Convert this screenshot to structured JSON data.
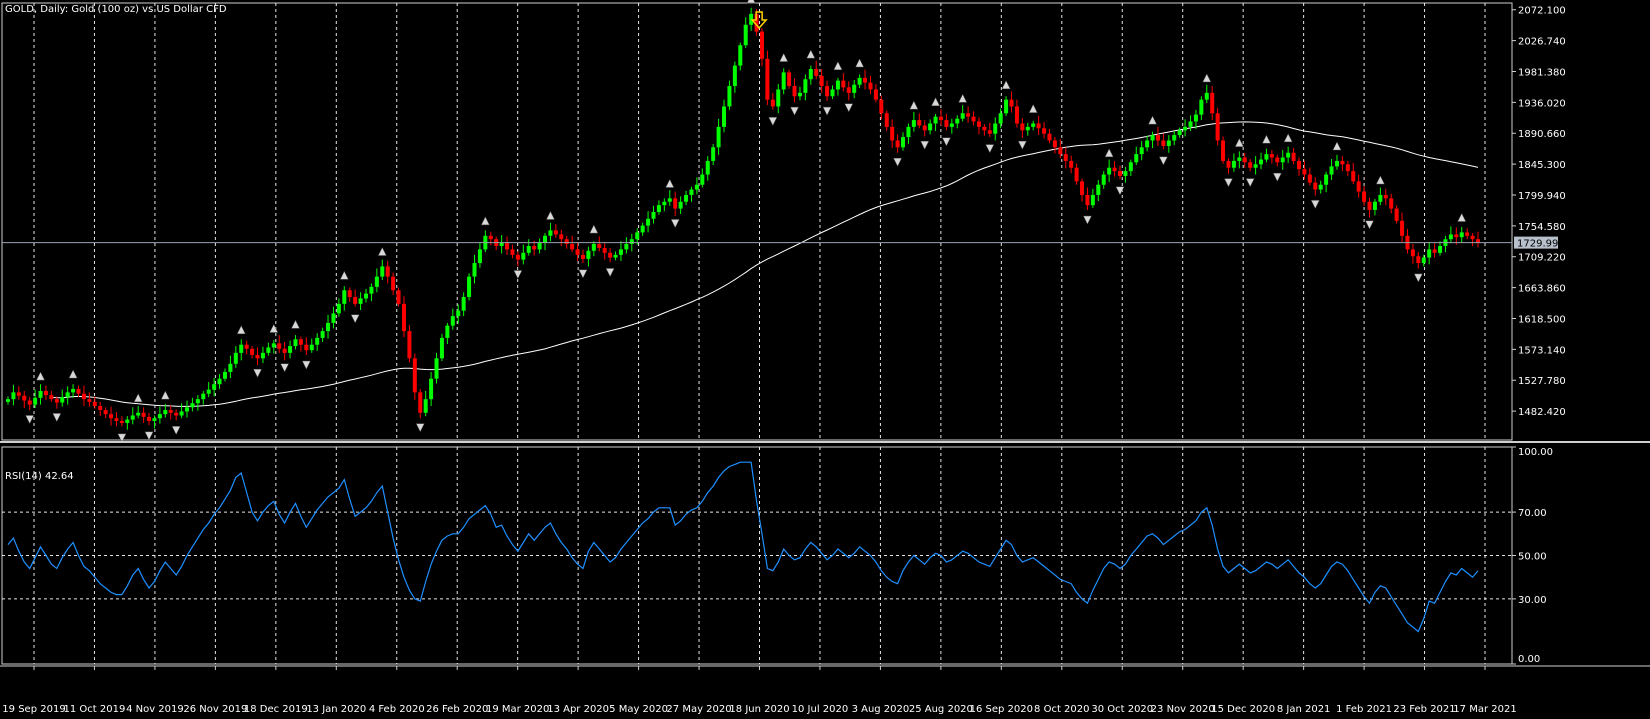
{
  "window": {
    "title": "GOLD, Daily:  Gold (100 oz) vs US Dollar CFD"
  },
  "chart_data": [
    {
      "type": "candlestick",
      "title": "GOLD, Daily:  Gold (100 oz) vs US Dollar CFD",
      "ylim": [
        1440,
        2082
      ],
      "price_ticks": [
        "2072.100",
        "2026.740",
        "1981.380",
        "1936.020",
        "1890.660",
        "1845.300",
        "1799.940",
        "1754.580",
        "1709.220",
        "1663.860",
        "1618.500",
        "1573.140",
        "1527.780",
        "1482.420"
      ],
      "current_price": {
        "value": 1729.99,
        "label": "1729.990"
      },
      "colors": {
        "up": "#00ff00",
        "down": "#ff0000",
        "ma": "#ffffff",
        "grid": "#ffffff",
        "price_line": "#9aa4b2"
      },
      "ma_period_note": "",
      "closes": [
        1500,
        1510,
        1505,
        1498,
        1492,
        1502,
        1512,
        1506,
        1500,
        1495,
        1503,
        1510,
        1515,
        1508,
        1500,
        1496,
        1490,
        1484,
        1478,
        1472,
        1468,
        1465,
        1470,
        1476,
        1480,
        1474,
        1468,
        1472,
        1478,
        1484,
        1480,
        1476,
        1482,
        1488,
        1494,
        1500,
        1508,
        1514,
        1522,
        1530,
        1540,
        1552,
        1568,
        1580,
        1574,
        1565,
        1560,
        1568,
        1576,
        1582,
        1574,
        1568,
        1578,
        1588,
        1580,
        1572,
        1580,
        1590,
        1600,
        1612,
        1626,
        1640,
        1660,
        1650,
        1640,
        1648,
        1655,
        1665,
        1680,
        1695,
        1680,
        1660,
        1640,
        1600,
        1560,
        1510,
        1480,
        1500,
        1530,
        1560,
        1590,
        1608,
        1622,
        1630,
        1650,
        1680,
        1700,
        1720,
        1740,
        1735,
        1725,
        1730,
        1720,
        1712,
        1705,
        1715,
        1725,
        1720,
        1730,
        1740,
        1748,
        1742,
        1735,
        1728,
        1720,
        1712,
        1706,
        1718,
        1728,
        1722,
        1715,
        1708,
        1712,
        1720,
        1728,
        1735,
        1745,
        1755,
        1765,
        1775,
        1785,
        1790,
        1795,
        1780,
        1790,
        1800,
        1808,
        1815,
        1830,
        1850,
        1870,
        1900,
        1930,
        1960,
        1990,
        2020,
        2050,
        2066,
        2040,
        2000,
        1940,
        1930,
        1955,
        1980,
        1960,
        1945,
        1950,
        1970,
        1985,
        1975,
        1960,
        1945,
        1955,
        1968,
        1958,
        1950,
        1962,
        1972,
        1965,
        1955,
        1940,
        1920,
        1900,
        1880,
        1870,
        1885,
        1900,
        1910,
        1902,
        1895,
        1905,
        1915,
        1910,
        1900,
        1905,
        1912,
        1920,
        1915,
        1908,
        1900,
        1895,
        1890,
        1905,
        1920,
        1940,
        1930,
        1905,
        1895,
        1900,
        1905,
        1898,
        1890,
        1880,
        1870,
        1860,
        1850,
        1840,
        1820,
        1800,
        1785,
        1800,
        1815,
        1830,
        1840,
        1835,
        1828,
        1835,
        1848,
        1860,
        1870,
        1880,
        1888,
        1880,
        1872,
        1880,
        1888,
        1895,
        1900,
        1908,
        1918,
        1940,
        1950,
        1920,
        1880,
        1850,
        1840,
        1850,
        1855,
        1848,
        1840,
        1845,
        1852,
        1860,
        1855,
        1848,
        1855,
        1862,
        1850,
        1838,
        1830,
        1818,
        1808,
        1815,
        1830,
        1842,
        1850,
        1845,
        1835,
        1820,
        1805,
        1790,
        1778,
        1790,
        1800,
        1795,
        1780,
        1762,
        1740,
        1720,
        1710,
        1700,
        1708,
        1720,
        1715,
        1725,
        1735,
        1742,
        1738,
        1745,
        1740,
        1735,
        1730
      ],
      "rsi": {
        "label": "RSI(14) 42.64",
        "ylim": [
          0,
          100
        ],
        "levels": [
          70,
          50,
          30
        ],
        "tick_labels": [
          "100.00",
          "70.00",
          "50.00",
          "30.00",
          "0.00"
        ],
        "color": "#1e90ff",
        "values": [
          55,
          58,
          52,
          47,
          44,
          49,
          54,
          50,
          46,
          44,
          49,
          53,
          56,
          50,
          45,
          43,
          40,
          37,
          35,
          33,
          32,
          32,
          36,
          41,
          44,
          39,
          35,
          38,
          43,
          47,
          44,
          41,
          45,
          50,
          54,
          58,
          62,
          65,
          69,
          72,
          76,
          80,
          86,
          88,
          79,
          70,
          66,
          70,
          73,
          75,
          69,
          65,
          70,
          74,
          68,
          63,
          67,
          71,
          74,
          77,
          79,
          81,
          85,
          76,
          68,
          70,
          72,
          75,
          79,
          82,
          70,
          58,
          48,
          40,
          34,
          30,
          29,
          38,
          46,
          52,
          57,
          59,
          60,
          60,
          63,
          67,
          69,
          71,
          73,
          69,
          63,
          64,
          59,
          55,
          52,
          56,
          60,
          57,
          60,
          63,
          65,
          60,
          56,
          53,
          49,
          46,
          44,
          52,
          56,
          53,
          50,
          47,
          49,
          53,
          56,
          59,
          62,
          65,
          67,
          70,
          72,
          72,
          72,
          64,
          66,
          69,
          71,
          72,
          75,
          79,
          82,
          86,
          89,
          91,
          92,
          93,
          93,
          93,
          75,
          60,
          44,
          43,
          47,
          53,
          50,
          48,
          49,
          53,
          56,
          54,
          51,
          48,
          50,
          53,
          51,
          49,
          51,
          54,
          52,
          50,
          47,
          43,
          40,
          38,
          37,
          43,
          47,
          50,
          48,
          46,
          49,
          51,
          50,
          47,
          48,
          50,
          52,
          51,
          49,
          47,
          46,
          45,
          49,
          53,
          57,
          55,
          50,
          47,
          48,
          49,
          47,
          45,
          43,
          41,
          39,
          38,
          37,
          33,
          30,
          28,
          34,
          39,
          44,
          47,
          46,
          44,
          46,
          50,
          53,
          56,
          59,
          60,
          58,
          55,
          57,
          59,
          61,
          62,
          64,
          66,
          70,
          72,
          64,
          53,
          45,
          42,
          44,
          46,
          44,
          42,
          43,
          45,
          47,
          46,
          44,
          46,
          48,
          45,
          42,
          40,
          37,
          35,
          37,
          41,
          45,
          47,
          46,
          43,
          39,
          35,
          31,
          28,
          33,
          36,
          35,
          31,
          27,
          23,
          19,
          17,
          15,
          21,
          29,
          28,
          33,
          38,
          42,
          41,
          44,
          42,
          40,
          43
        ]
      },
      "x_tick_labels": [
        "19 Sep 2019",
        "11 Oct 2019",
        "4 Nov 2019",
        "26 Nov 2019",
        "18 Dec 2019",
        "13 Jan 2020",
        "4 Feb 2020",
        "26 Feb 2020",
        "19 Mar 2020",
        "13 Apr 2020",
        "5 May 2020",
        "27 May 2020",
        "18 Jun 2020",
        "10 Jul 2020",
        "3 Aug 2020",
        "25 Aug 2020",
        "16 Sep 2020",
        "8 Oct 2020",
        "30 Oct 2020",
        "23 Nov 2020",
        "15 Dec 2020",
        "8 Jan 2021",
        "1 Feb 2021",
        "23 Feb 2021",
        "17 Mar 2021"
      ],
      "grid": true
    }
  ]
}
